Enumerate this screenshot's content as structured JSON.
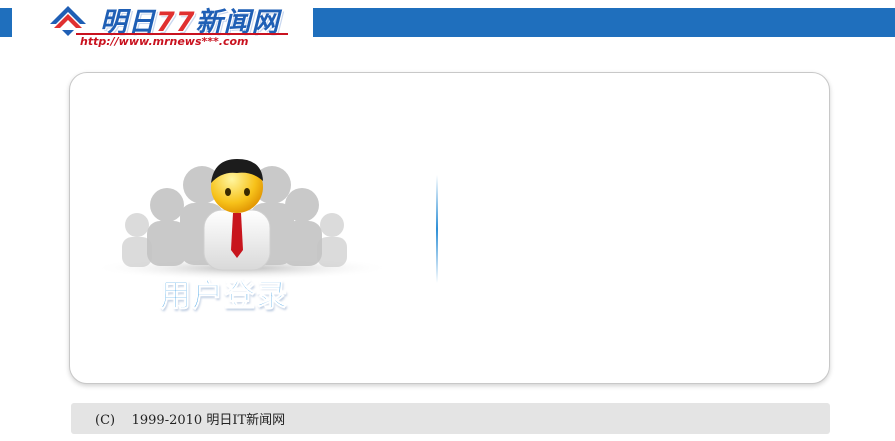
{
  "header": {
    "logo_title_part1": "明日",
    "logo_title_part2": "77",
    "logo_title_part3": "新闻网",
    "logo_url": "http://www.mrnews***.com",
    "bar_color": "#1f6fbd"
  },
  "login_panel": {
    "title": "用户登录",
    "illustration_icon": "user-group-icon"
  },
  "footer": {
    "copyright": "(C)    1999-2010 明日IT新闻网"
  }
}
